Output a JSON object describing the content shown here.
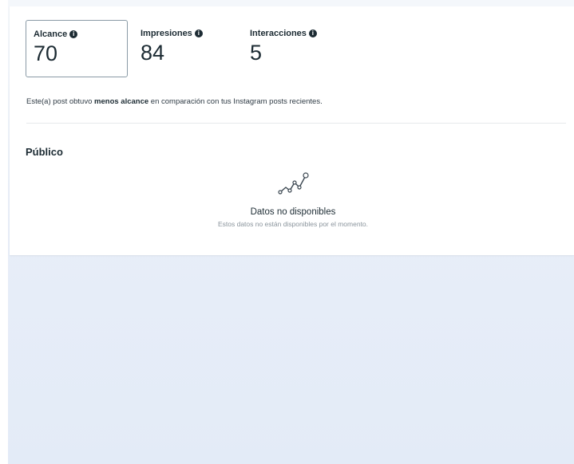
{
  "metrics": [
    {
      "label": "Alcance",
      "value": "70",
      "selected": true
    },
    {
      "label": "Impresiones",
      "value": "84",
      "selected": false
    },
    {
      "label": "Interacciones",
      "value": "5",
      "selected": false
    }
  ],
  "note": {
    "prefix": "Este(a) post obtuvo ",
    "emphasis": "menos alcance",
    "suffix": " en comparación con tus Instagram posts recientes."
  },
  "audience": {
    "title": "Público",
    "empty_icon": "line-chart-icon",
    "empty_title": "Datos no disponibles",
    "empty_subtitle": "Estos datos no están disponibles por el momento."
  },
  "colors": {
    "text": "#1c2b33",
    "selected_border": "#8a9aa6",
    "muted": "#8a949c",
    "backdrop": "#e8eef8"
  }
}
